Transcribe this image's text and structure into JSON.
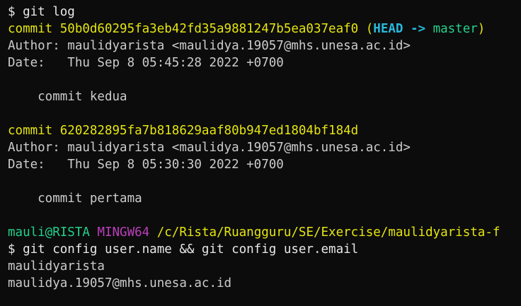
{
  "terminal": {
    "top_fragment": "  ",
    "lines": [
      {
        "segments": [
          {
            "text": "$ git log",
            "cls": "dollar"
          }
        ]
      },
      {
        "segments": [
          {
            "text": "commit 50b0d60295fa3eb42fd35a9881247b5ea037eaf0 ",
            "cls": "yellow"
          },
          {
            "text": "(",
            "cls": "yellow"
          },
          {
            "text": "HEAD -> ",
            "cls": "cyan"
          },
          {
            "text": "master",
            "cls": "green"
          },
          {
            "text": ")",
            "cls": "yellow"
          }
        ]
      },
      {
        "segments": [
          {
            "text": "Author: maulidyarista <maulidya.19057@mhs.unesa.ac.id>",
            "cls": "normal"
          }
        ]
      },
      {
        "segments": [
          {
            "text": "Date:   Thu Sep 8 05:45:28 2022 +0700",
            "cls": "normal"
          }
        ]
      },
      {
        "segments": []
      },
      {
        "segments": [
          {
            "text": "    commit kedua",
            "cls": "normal"
          }
        ]
      },
      {
        "segments": []
      },
      {
        "segments": [
          {
            "text": "commit 620282895fa7b818629aaf80b947ed1804bf184d",
            "cls": "yellow"
          }
        ]
      },
      {
        "segments": [
          {
            "text": "Author: maulidyarista <maulidya.19057@mhs.unesa.ac.id>",
            "cls": "normal"
          }
        ]
      },
      {
        "segments": [
          {
            "text": "Date:   Thu Sep 8 05:30:30 2022 +0700",
            "cls": "normal"
          }
        ]
      },
      {
        "segments": []
      },
      {
        "segments": [
          {
            "text": "    commit pertama",
            "cls": "normal"
          }
        ]
      },
      {
        "segments": []
      },
      {
        "segments": [
          {
            "text": "mauli@RISTA ",
            "cls": "green"
          },
          {
            "text": "MINGW64 ",
            "cls": "magenta"
          },
          {
            "text": "/c/Rista/Ruangguru/SE/Exercise/maulidyarista-f",
            "cls": "yellow"
          }
        ]
      },
      {
        "segments": [
          {
            "text": "$ git config user.name && git config user.email",
            "cls": "dollar"
          }
        ]
      },
      {
        "segments": [
          {
            "text": "maulidyarista",
            "cls": "normal"
          }
        ]
      },
      {
        "segments": [
          {
            "text": "maulidya.19057@mhs.unesa.ac.id",
            "cls": "normal"
          }
        ]
      }
    ]
  }
}
